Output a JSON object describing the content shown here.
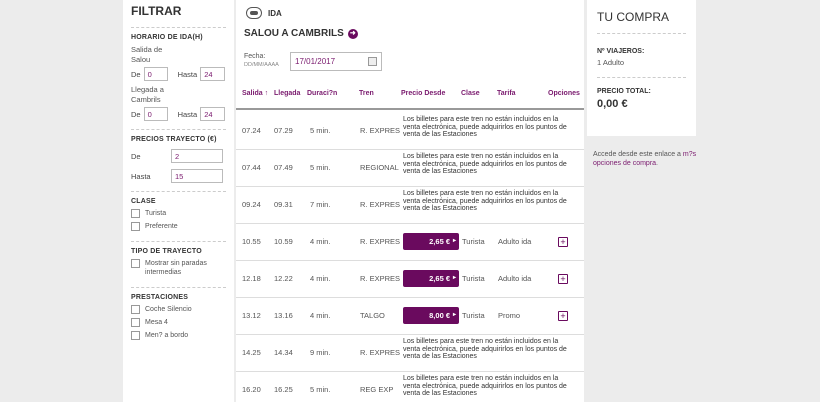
{
  "filter": {
    "title": "FILTRAR",
    "horario": {
      "title": "HORARIO DE IDA(H)",
      "salida_label": "Salida de Salou",
      "llegada_label": "Llegada a Cambrils",
      "de_label": "De",
      "hasta_label": "Hasta",
      "salida_de": "0",
      "salida_hasta": "24",
      "llegada_de": "0",
      "llegada_hasta": "24"
    },
    "precios": {
      "title": "PRECIOS TRAYECTO (€)",
      "de_label": "De",
      "hasta_label": "Hasta",
      "de_value": "2",
      "hasta_value": "15"
    },
    "clase": {
      "title": "CLASE",
      "options": [
        "Turista",
        "Preferente"
      ]
    },
    "tipo": {
      "title": "TIPO DE TRAYECTO",
      "options": [
        "Mostrar sin paradas intermedias"
      ]
    },
    "prestaciones": {
      "title": "PRESTACIONES",
      "options": [
        "Coche Silencio",
        "Mesa 4",
        "Men? a bordo"
      ]
    }
  },
  "main": {
    "ida_label": "IDA",
    "route": "SALOU A CAMBRILS",
    "fecha_label": "Fecha:",
    "fecha_format": "DD/MM/AAAA",
    "fecha_value": "17/01/2017",
    "columns": [
      "Salida ↑",
      "Llegada",
      "Duraci?n",
      "Tren",
      "Precio Desde",
      "Clase",
      "Tarifa",
      "Opciones"
    ],
    "no_sale_note": "Los billetes para este tren no están incluidos en la venta electrónica, puede adquirirlos en los puntos de venta de las Estaciones",
    "rows": [
      {
        "salida": "07.24",
        "llegada": "07.29",
        "duracion": "5 min.",
        "tren": "R. EXPRES"
      },
      {
        "salida": "07.44",
        "llegada": "07.49",
        "duracion": "5 min.",
        "tren": "REGIONAL"
      },
      {
        "salida": "09.24",
        "llegada": "09.31",
        "duracion": "7 min.",
        "tren": "R. EXPRES"
      },
      {
        "salida": "10.55",
        "llegada": "10.59",
        "duracion": "4 min.",
        "tren": "R. EXPRES",
        "precio": "2,65 €",
        "clase": "Turista",
        "tarifa": "Adulto ida"
      },
      {
        "salida": "12.18",
        "llegada": "12.22",
        "duracion": "4 min.",
        "tren": "R. EXPRES",
        "precio": "2,65 €",
        "clase": "Turista",
        "tarifa": "Adulto ida"
      },
      {
        "salida": "13.12",
        "llegada": "13.16",
        "duracion": "4 min.",
        "tren": "TALGO",
        "precio": "8,00 €",
        "clase": "Turista",
        "tarifa": "Promo"
      },
      {
        "salida": "14.25",
        "llegada": "14.34",
        "duracion": "9 min.",
        "tren": "R. EXPRES"
      },
      {
        "salida": "16.20",
        "llegada": "16.25",
        "duracion": "5 min.",
        "tren": "REG EXP"
      }
    ]
  },
  "summary": {
    "title": "TU COMPRA",
    "viajeros_label": "Nº VIAJEROS:",
    "viajeros_value": "1 Adulto",
    "total_label": "PRECIO TOTAL:",
    "total_value": "0,00 €"
  },
  "side_note": {
    "text": "Accede desde este enlace a ",
    "link": "m?s opciones de compra",
    "end": "."
  },
  "colors": {
    "accent": "#6a0a5e",
    "text": "#444444",
    "background": "#ececec"
  }
}
